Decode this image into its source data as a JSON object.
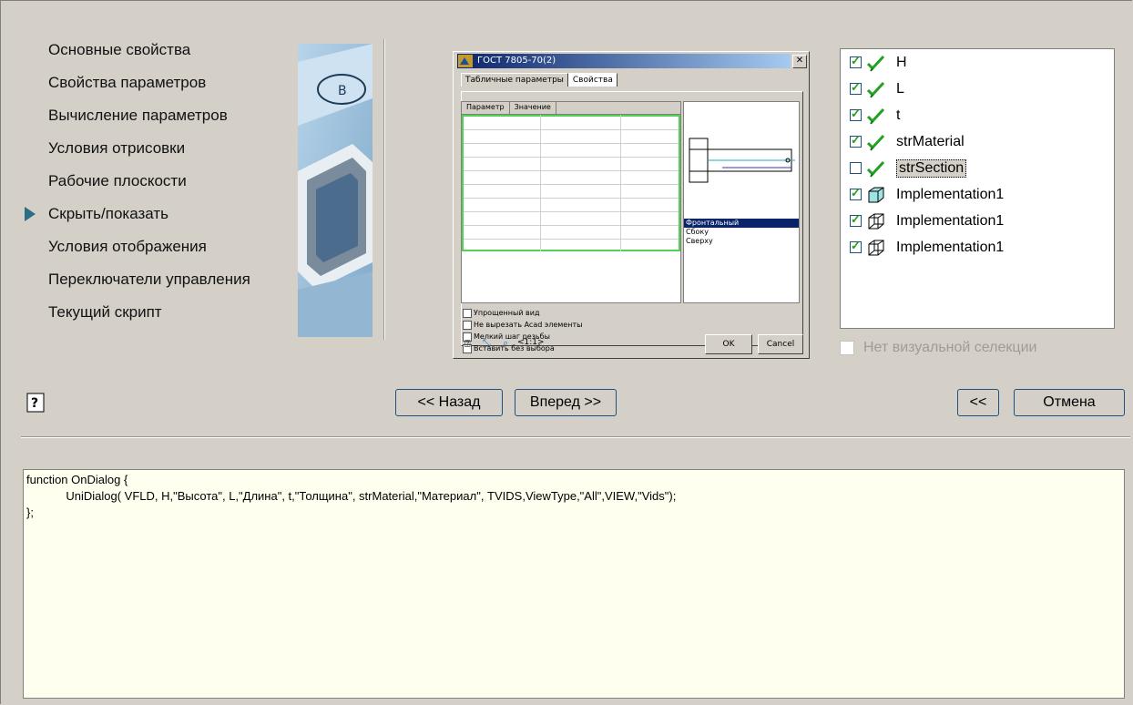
{
  "wizard_steps": [
    {
      "label": "Основные свойства",
      "active": false
    },
    {
      "label": "Свойства параметров",
      "active": false
    },
    {
      "label": "Вычисление параметров",
      "active": false
    },
    {
      "label": "Условия отрисовки",
      "active": false
    },
    {
      "label": "Рабочие плоскости",
      "active": false
    },
    {
      "label": "Скрыть/показать",
      "active": true
    },
    {
      "label": "Условия отображения",
      "active": false
    },
    {
      "label": "Переключатели управления",
      "active": false
    },
    {
      "label": "Текущий скрипт",
      "active": false
    }
  ],
  "preview": {
    "title": "ГОСТ 7805-70(2)",
    "tabs": [
      "Табличные параметры",
      "Свойства"
    ],
    "columns": [
      "Параметр",
      "Значение"
    ],
    "checkboxes": [
      "Упрощенный вид",
      "Не вырезать Acad элементы",
      "Мелкий шаг резьбы",
      "Вставить без выбора"
    ],
    "views": [
      "Фронтальный",
      "Сбоку",
      "Сверху"
    ],
    "selected_view": "Фронтальный",
    "zoom": "<1:1>",
    "ok": "OK",
    "cancel": "Cancel"
  },
  "tree": [
    {
      "label": "H",
      "checked": true,
      "icon": "check-mark-icon"
    },
    {
      "label": "L",
      "checked": true,
      "icon": "check-mark-icon"
    },
    {
      "label": "t",
      "checked": true,
      "icon": "check-mark-icon"
    },
    {
      "label": "strMaterial",
      "checked": true,
      "icon": "check-mark-icon"
    },
    {
      "label": "strSection",
      "checked": false,
      "icon": "check-mark-icon",
      "selected": true
    },
    {
      "label": "Implementation1",
      "checked": true,
      "icon": "cube-solid-icon"
    },
    {
      "label": "Implementation1",
      "checked": true,
      "icon": "cube-wire-icon"
    },
    {
      "label": "Implementation1",
      "checked": true,
      "icon": "cube-wire-icon"
    }
  ],
  "no_visual_selection": "Нет визуальной селекции",
  "buttons": {
    "back": "<< Назад",
    "next": "Вперед >>",
    "collapse": "<<",
    "cancel": "Отмена"
  },
  "script": {
    "line1": "function OnDialog {",
    "line2": "            UniDialog( VFLD, H,\"Высота\", L,\"Длина\", t,\"Толщина\", strMaterial,\"Материал\", TVIDS,ViewType,\"All\",VIEW,\"Vids\");",
    "line3": "};"
  },
  "colors": {
    "background": "#d4d0c8",
    "accent_border": "#1c5180",
    "check_green": "#21a121",
    "script_bg": "#ffffef"
  }
}
